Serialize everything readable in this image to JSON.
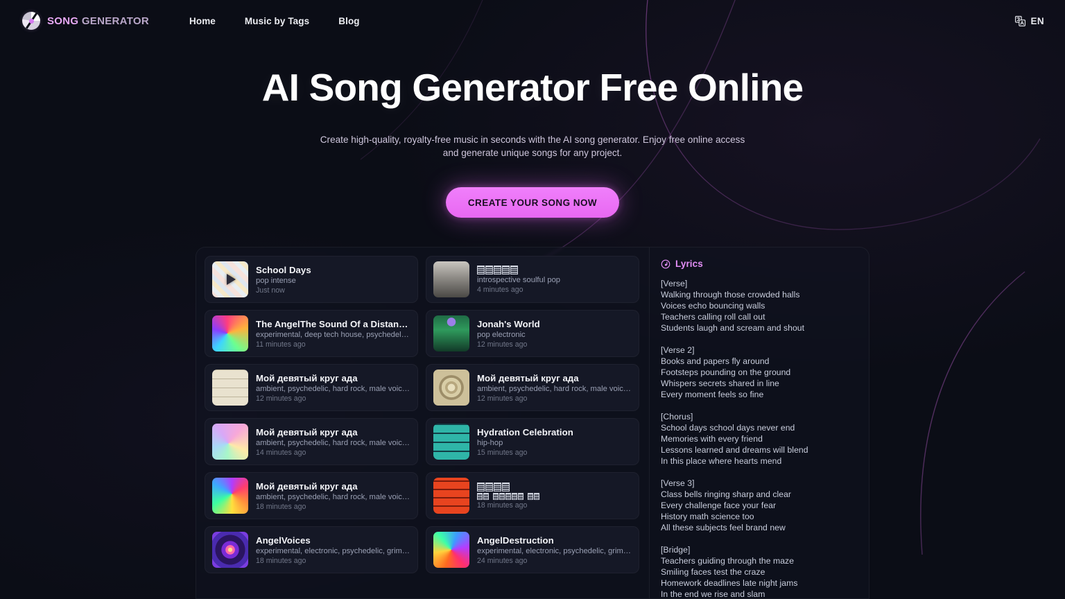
{
  "nav": {
    "logo_icon": "vinyl-disc-icon",
    "brand_primary": "SONG",
    "brand_secondary": "GENERATOR",
    "links": [
      {
        "label": "Home"
      },
      {
        "label": "Music by Tags"
      },
      {
        "label": "Blog"
      }
    ],
    "language": {
      "icon": "translate-icon",
      "label": "EN"
    }
  },
  "hero": {
    "title": "AI Song Generator Free Online",
    "subtitle": "Create high-quality, royalty-free music in seconds with the AI song generator. Enjoy free online access and generate unique songs for any project.",
    "cta_label": "CREATE YOUR SONG NOW",
    "cta_color": "#ef7ffb"
  },
  "songs": {
    "left_column": [
      {
        "title": "School Days",
        "genre": "pop intense",
        "time": "Just now",
        "thumb": "collage-school-supplies",
        "playing": true
      },
      {
        "title": "The AngelThe Sound Of a Distant…",
        "genre": "experimental, deep tech house, psychedelic,…",
        "time": "11 minutes ago",
        "thumb": "rainbow-spiral",
        "playing": false
      },
      {
        "title": "Мой девятый круг ада",
        "genre": "ambient, psychedelic, hard rock, male voice, nu…",
        "time": "12 minutes ago",
        "thumb": "sepia-clock-grid",
        "playing": false
      },
      {
        "title": "Мой девятый круг ада",
        "genre": "ambient, psychedelic, hard rock, male voice, nu…",
        "time": "14 minutes ago",
        "thumb": "pastel-swirl",
        "playing": false
      },
      {
        "title": "Мой девятый круг ада",
        "genre": "ambient, psychedelic, hard rock, male voice, nu…",
        "time": "18 minutes ago",
        "thumb": "vivid-swirl",
        "playing": false
      },
      {
        "title": "AngelVoices",
        "genre": "experimental, electronic, psychedelic, grime,…",
        "time": "18 minutes ago",
        "thumb": "neon-mandala",
        "playing": false
      }
    ],
    "right_column": [
      {
        "title": "",
        "title_tofu": 5,
        "genre": "introspective soulful pop",
        "time": "4 minutes ago",
        "thumb": "grey-corridor",
        "playing": false
      },
      {
        "title": "Jonah's World",
        "genre": "pop electronic",
        "time": "12 minutes ago",
        "thumb": "green-jungle",
        "playing": false
      },
      {
        "title": "Мой девятый круг ада",
        "genre": "ambient, psychedelic, hard rock, male voice, nu…",
        "time": "12 minutes ago",
        "thumb": "tan-zodiac-wheel",
        "playing": false
      },
      {
        "title": "Hydration Celebration",
        "genre": "hip-hop",
        "time": "15 minutes ago",
        "thumb": "teal-tile-grid",
        "playing": false
      },
      {
        "title": "",
        "title_tofu": 4,
        "genre": "",
        "genre_tofu": [
          2,
          5,
          2
        ],
        "time": "18 minutes ago",
        "thumb": "red-temple-grid",
        "playing": false
      },
      {
        "title": "AngelDestruction",
        "genre": "experimental, electronic, psychedelic, grime,…",
        "time": "24 minutes ago",
        "thumb": "orange-swirl",
        "playing": false
      }
    ]
  },
  "lyrics": {
    "icon": "disc-note-icon",
    "heading": "Lyrics",
    "text": "[Verse]\nWalking through those crowded halls\nVoices echo bouncing walls\nTeachers calling roll call out\nStudents laugh and scream and shout\n\n[Verse 2]\nBooks and papers fly around\nFootsteps pounding on the ground\nWhispers secrets shared in line\nEvery moment feels so fine\n\n[Chorus]\nSchool days school days never end\nMemories with every friend\nLessons learned and dreams will blend\nIn this place where hearts mend\n\n[Verse 3]\nClass bells ringing sharp and clear\nEvery challenge face your fear\nHistory math science too\nAll these subjects feel brand new\n\n[Bridge]\nTeachers guiding through the maze\nSmiling faces test the craze\nHomework deadlines late night jams\nIn the end we rise and slam"
  }
}
